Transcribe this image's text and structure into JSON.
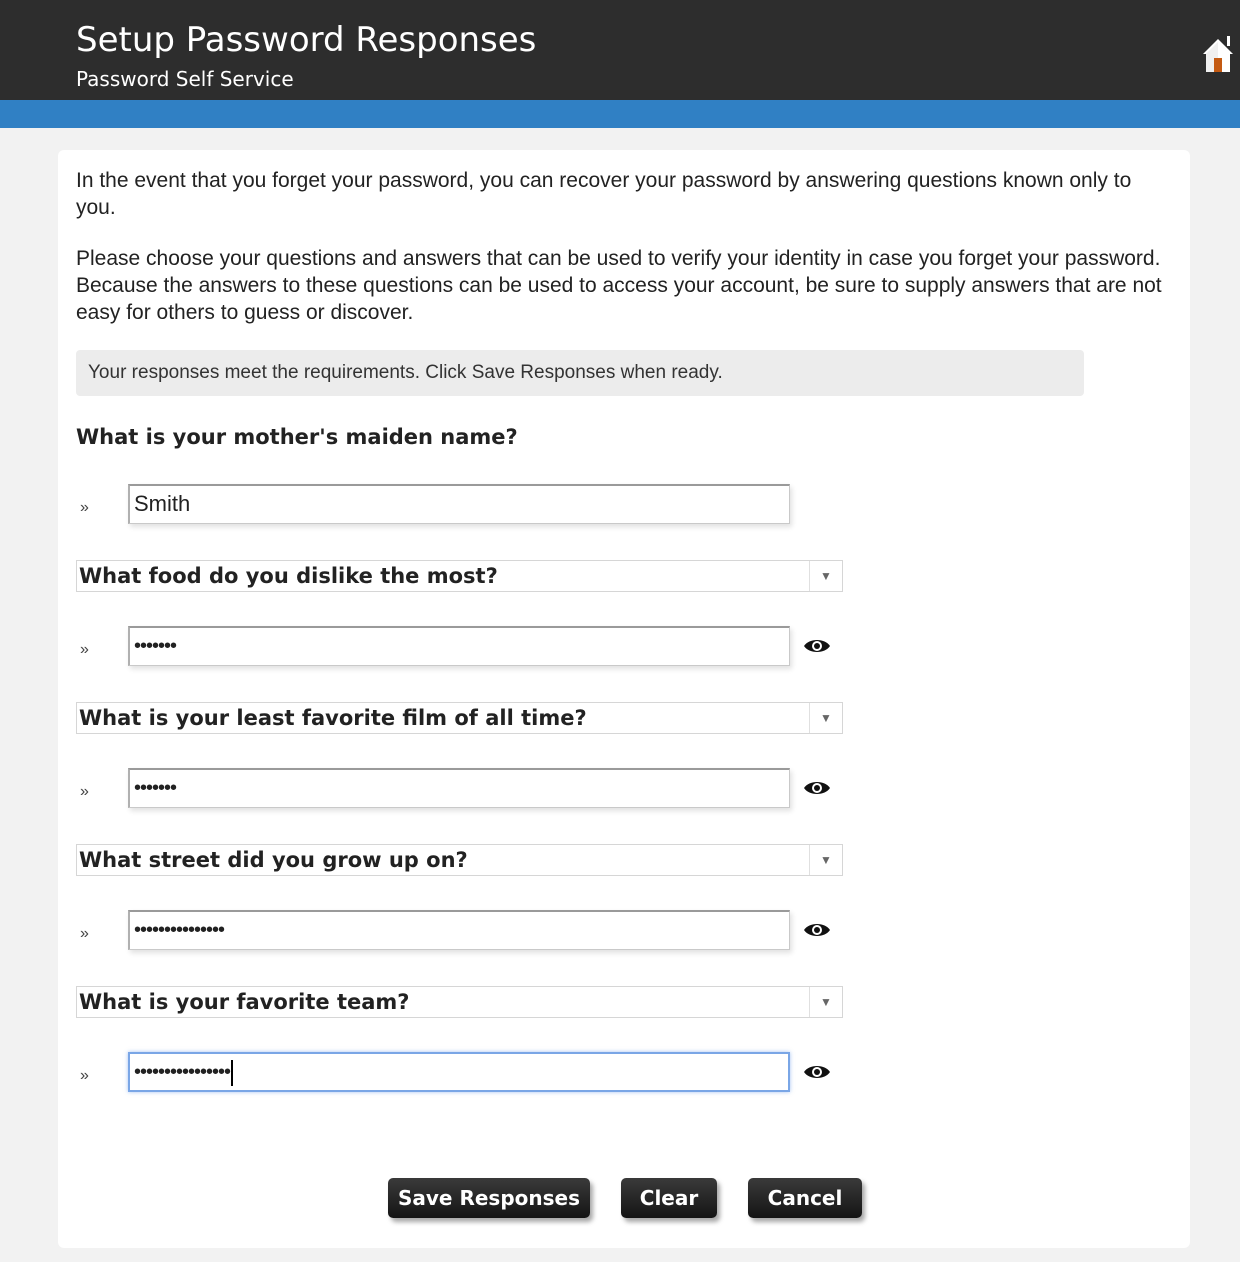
{
  "header": {
    "title": "Setup Password Responses",
    "subtitle": "Password Self Service",
    "home_icon": "home-icon"
  },
  "intro": {
    "paragraph1": "In the event that you forget your password, you can recover your password by answering questions known only to you.",
    "paragraph2": "Please choose your questions and answers that can be used to verify your identity in case you forget your password. Because the answers to these questions can be used to access your account, be sure to supply answers that are not easy for others to guess or discover."
  },
  "message": "Your responses meet the requirements. Click Save Responses when ready.",
  "questions": [
    {
      "question": "What is your mother's maiden name?",
      "answer": "Smith"
    },
    {
      "question": "What food do you dislike the most?",
      "answer": "•••••••"
    },
    {
      "question": "What is your least favorite film of all time?",
      "answer": "•••••••"
    },
    {
      "question": "What street did you grow up on?",
      "answer": "•••••••••••••••"
    },
    {
      "question": "What is your favorite team?",
      "answer": "••••••••••••••••"
    }
  ],
  "bullet": "»",
  "buttons": {
    "save": "Save Responses",
    "clear": "Clear",
    "cancel": "Cancel"
  },
  "colors": {
    "header_bg": "#2d2d2d",
    "accent_bar": "#3080c4",
    "button_bg": "#1e1e1e"
  }
}
